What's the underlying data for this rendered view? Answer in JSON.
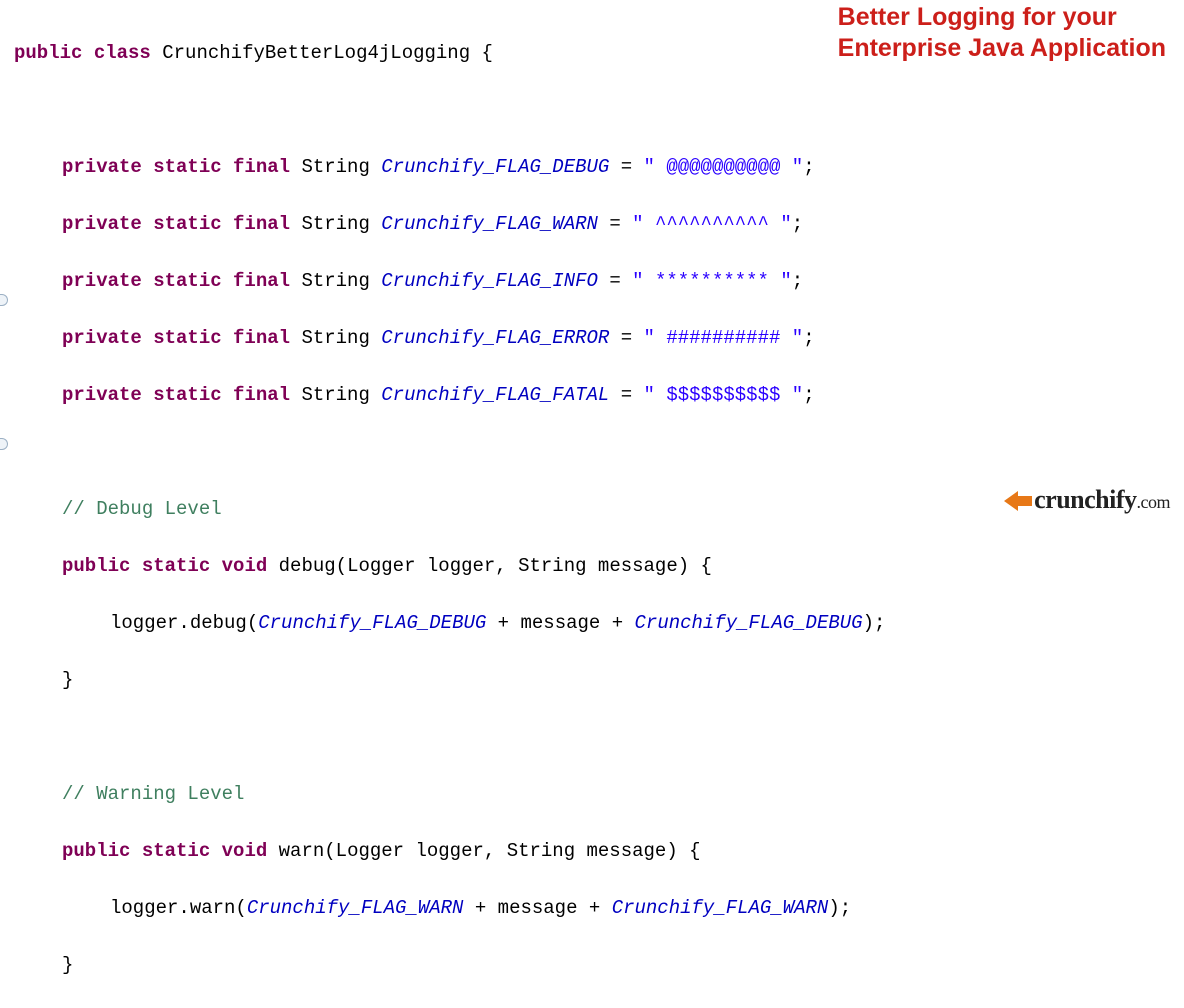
{
  "headline": {
    "line1": "Better Logging for your",
    "line2": "Enterprise Java Application"
  },
  "cls": {
    "decl_public": "public",
    "decl_class": "class",
    "name": "CrunchifyBetterLog4jLogging",
    "brace_open": " {"
  },
  "fields": [
    {
      "mods": "private static final",
      "type": "String",
      "name": "Crunchify_FLAG_DEBUG",
      "eq": " = ",
      "value": "\" @@@@@@@@@@ \"",
      "semi": ";"
    },
    {
      "mods": "private static final",
      "type": "String",
      "name": "Crunchify_FLAG_WARN",
      "eq": " = ",
      "value": "\" ^^^^^^^^^^ \"",
      "semi": ";"
    },
    {
      "mods": "private static final",
      "type": "String",
      "name": "Crunchify_FLAG_INFO",
      "eq": " = ",
      "value": "\" ********** \"",
      "semi": ";"
    },
    {
      "mods": "private static final",
      "type": "String",
      "name": "Crunchify_FLAG_ERROR",
      "eq": " = ",
      "value": "\" ########## \"",
      "semi": ";"
    },
    {
      "mods": "private static final",
      "type": "String",
      "name": "Crunchify_FLAG_FATAL",
      "eq": " = ",
      "value": "\" $$$$$$$$$$ \"",
      "semi": ";"
    }
  ],
  "methods": {
    "debug": {
      "comment": "// Debug Level",
      "sig_mods": "public static",
      "sig_ret": "void",
      "sig_name": "debug",
      "sig_params": "(Logger logger, String message) {",
      "body_pre": "logger.debug(",
      "body_flag": "Crunchify_FLAG_DEBUG",
      "body_mid": " + message + ",
      "body_post": ");",
      "close": "}"
    },
    "warn": {
      "comment": "// Warning Level",
      "sig_mods": "public static",
      "sig_ret": "void",
      "sig_name": "warn",
      "sig_params": "(Logger logger, String message) {",
      "body_pre": "logger.warn(",
      "body_flag": "Crunchify_FLAG_WARN",
      "body_mid": " + message + ",
      "body_post": ");",
      "close": "}"
    }
  },
  "logo": {
    "brand": "crunchify",
    "tld": ".com"
  }
}
